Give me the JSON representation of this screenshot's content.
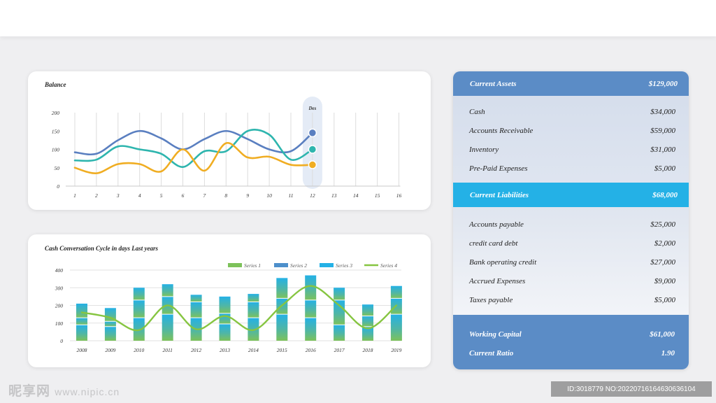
{
  "watermark": {
    "brand": "昵享网",
    "url": "www.nipic.cn",
    "id_text": "ID:3018779 NO:20220716164630636104"
  },
  "chart_data": [
    {
      "type": "line",
      "title": "Balance",
      "x": [
        "1",
        "2",
        "3",
        "4",
        "5",
        "6",
        "7",
        "8",
        "9",
        "10",
        "11",
        "12",
        "13",
        "14",
        "15",
        "16"
      ],
      "ylim": [
        0,
        200
      ],
      "yticks": [
        "0",
        "50",
        "100",
        "150",
        "200"
      ],
      "highlight": {
        "category": "12",
        "label": "Des"
      },
      "grid": "vertical",
      "series": [
        {
          "color": "#5a7fc0",
          "values": [
            92,
            88,
            125,
            150,
            130,
            100,
            128,
            150,
            128,
            100,
            95,
            145
          ]
        },
        {
          "color": "#2eb5ae",
          "values": [
            70,
            72,
            108,
            100,
            88,
            52,
            95,
            95,
            150,
            140,
            72,
            100
          ]
        },
        {
          "color": "#f0ad22",
          "values": [
            50,
            35,
            60,
            60,
            40,
            100,
            42,
            117,
            78,
            80,
            58,
            58
          ]
        }
      ]
    },
    {
      "type": "bar",
      "title": "Cash Conversation Cycle in days Last years",
      "categories": [
        "2008",
        "2009",
        "2010",
        "2011",
        "2012",
        "2013",
        "2014",
        "2015",
        "2016",
        "2017",
        "2018",
        "2019"
      ],
      "ylim": [
        0,
        400
      ],
      "yticks": [
        "0",
        "100",
        "200",
        "300",
        "400"
      ],
      "legend": "top-right",
      "series": [
        {
          "name": "Series 1",
          "type": "bar",
          "values": [
            90,
            80,
            130,
            150,
            130,
            95,
            130,
            150,
            130,
            90,
            80,
            150
          ]
        },
        {
          "name": "Series 2",
          "type": "bar",
          "values": [
            40,
            30,
            100,
            100,
            90,
            60,
            90,
            90,
            100,
            140,
            60,
            90
          ]
        },
        {
          "name": "Series 3",
          "type": "bar",
          "values": [
            80,
            75,
            70,
            70,
            40,
            95,
            45,
            115,
            140,
            70,
            65,
            70
          ]
        },
        {
          "name": "Series 4",
          "type": "line",
          "values": [
            160,
            130,
            60,
            200,
            65,
            140,
            60,
            200,
            310,
            200,
            70,
            200
          ]
        }
      ],
      "colors": {
        "Series 1": "#7dc25a",
        "Series 2": "#4d8fcb",
        "Series 3": "#24b1e6",
        "Series 4": "#86c541"
      }
    }
  ],
  "balance_sheet": {
    "current_assets": {
      "label": "Current Assets",
      "value": "$129,000"
    },
    "assets": [
      {
        "label": "Cash",
        "value": "$34,000"
      },
      {
        "label": "Accounts Receivable",
        "value": "$59,000"
      },
      {
        "label": "Inventory",
        "value": "$31,000"
      },
      {
        "label": "Pre-Paid Expenses",
        "value": "$5,000"
      }
    ],
    "current_liabilities": {
      "label": "Current Liabilities",
      "value": "$68,000"
    },
    "liabilities": [
      {
        "label": "Accounts payable",
        "value": "$25,000"
      },
      {
        "label": "credit card debt",
        "value": "$2,000"
      },
      {
        "label": "Bank operating credit",
        "value": "$27,000"
      },
      {
        "label": "Accrued Expenses",
        "value": "$9,000"
      },
      {
        "label": "Taxes payable",
        "value": "$5,000"
      }
    ],
    "working_capital": {
      "label": "Working Capital",
      "value": "$61,000"
    },
    "current_ratio": {
      "label": "Current Ratio",
      "value": "1.90"
    }
  },
  "colors": {
    "assets_band": "#5b8cc6",
    "liabilities_band": "#24b1e6",
    "footer_band": "#5b8cc6"
  }
}
